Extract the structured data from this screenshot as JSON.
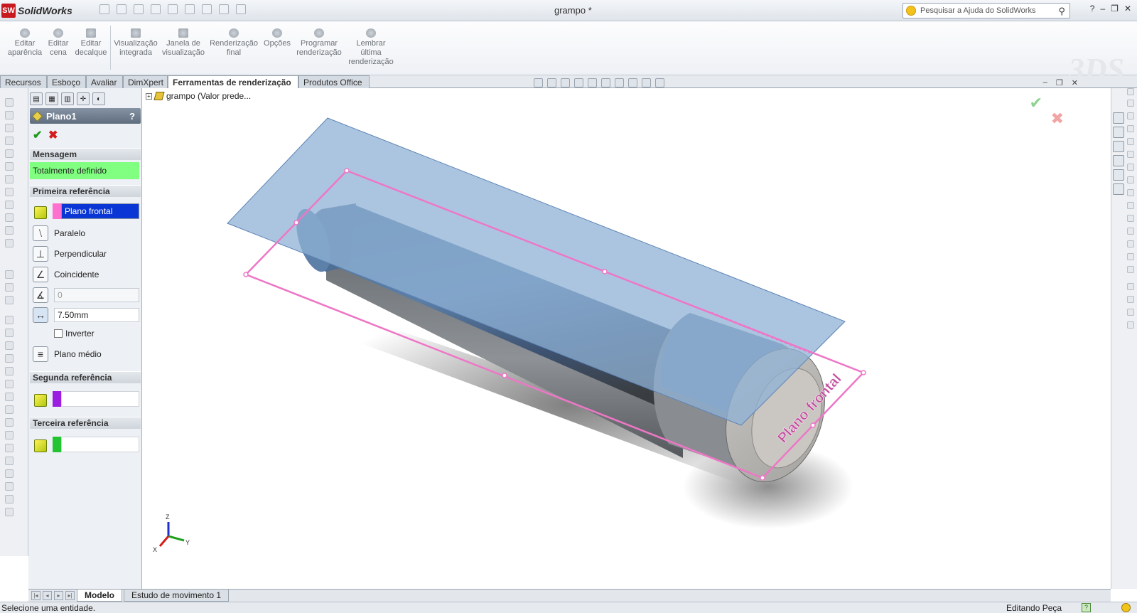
{
  "app": {
    "name": "SolidWorks",
    "logo_letters": "SW",
    "document_title": "grampo *",
    "search_placeholder": "Pesquisar a Ajuda do SolidWorks",
    "window_controls": [
      "?",
      "–",
      "❐",
      "✕"
    ]
  },
  "ribbon": {
    "buttons": [
      {
        "line1": "Editar",
        "line2": "aparência",
        "line3": ""
      },
      {
        "line1": "Editar",
        "line2": "cena",
        "line3": ""
      },
      {
        "line1": "Editar",
        "line2": "decalque",
        "line3": ""
      },
      {
        "line1": "Visualização",
        "line2": "integrada",
        "line3": ""
      },
      {
        "line1": "Janela de",
        "line2": "visualização",
        "line3": ""
      },
      {
        "line1": "Renderização",
        "line2": "final",
        "line3": ""
      },
      {
        "line1": "Opções",
        "line2": "",
        "line3": ""
      },
      {
        "line1": "Programar",
        "line2": "renderização",
        "line3": ""
      },
      {
        "line1": "Lembrar",
        "line2": "última",
        "line3": "renderização"
      }
    ]
  },
  "tabs": [
    {
      "label": "Recursos"
    },
    {
      "label": "Esboço"
    },
    {
      "label": "Avaliar"
    },
    {
      "label": "DimXpert"
    },
    {
      "label": "Ferramentas de renderização"
    },
    {
      "label": "Produtos Office"
    }
  ],
  "property_manager": {
    "title": "Plano1",
    "help": "?",
    "ok_symbol": "✔",
    "cancel_symbol": "✖",
    "message_section": "Mensagem",
    "message": "Totalmente definido",
    "first_ref_section": "Primeira referência",
    "first_ref_value": "Plano frontal",
    "first_ref_color": "#ff6fcf",
    "options": [
      {
        "label": "Paralelo",
        "glyph": "⧵"
      },
      {
        "label": "Perpendicular",
        "glyph": "⊥"
      },
      {
        "label": "Coincidente",
        "glyph": "∠"
      }
    ],
    "angle_value": "0",
    "distance_value": "7.50mm",
    "invert_label": "Inverter",
    "mid_plane_label": "Plano médio",
    "second_ref_section": "Segunda referência",
    "second_ref_color": "#9b1fe0",
    "third_ref_section": "Terceira referência",
    "third_ref_color": "#22c431"
  },
  "viewport": {
    "tree_root": "grampo  (Valor prede...",
    "plane_label": "Plano frontal",
    "triad": {
      "z": "Z",
      "y": "Y",
      "x": "X"
    },
    "colors": {
      "plane": "#8fb2d6",
      "plane_edge": "#5d84b5",
      "highlight": "#ee76c6",
      "part": "#8a8d90"
    }
  },
  "bottom_tabs": [
    {
      "label": "Modelo"
    },
    {
      "label": "Estudo de movimento 1"
    }
  ],
  "status": {
    "left": "Selecione uma entidade.",
    "right": "Editando Peça",
    "help": "?"
  }
}
